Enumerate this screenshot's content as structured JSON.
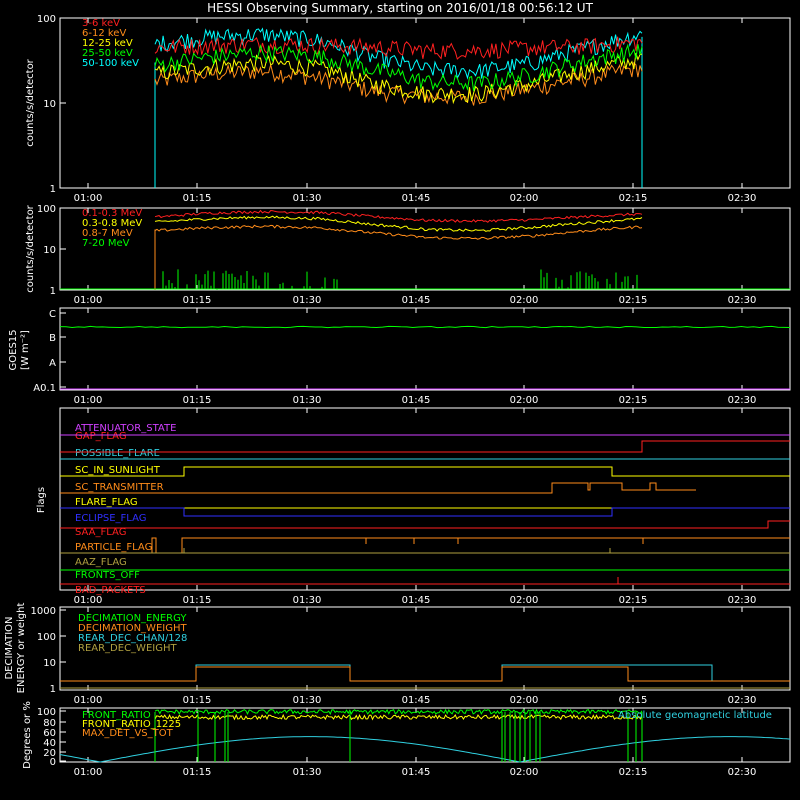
{
  "title": "HESSI Observing Summary, starting on 2016/01/18 00:56:12 UT",
  "x_ticks": [
    "01:00",
    "01:15",
    "01:30",
    "01:45",
    "02:00",
    "02:15",
    "02:30"
  ],
  "colors": {
    "red": "#ff2020",
    "orange": "#ff8c1a",
    "yellow": "#ffff00",
    "green": "#00ff00",
    "cyan": "#00ffff",
    "blue": "#3030ff",
    "magenta": "#d040ff",
    "olive": "#b0a040",
    "teal": "#30d0e0"
  },
  "chart_data": [
    {
      "type": "line",
      "ylabel": "counts/s/detector",
      "y_scale": "log",
      "ylim": [
        1,
        100
      ],
      "y_ticks": [
        "100",
        "10",
        "1"
      ],
      "x_range": [
        "00:56:12",
        "02:36:12"
      ],
      "data_span": [
        "01:09:30",
        "02:16:00"
      ],
      "series": [
        {
          "name": "3-6 keV",
          "color": "#ff2020",
          "values": [
            45,
            48,
            50,
            48,
            46,
            42,
            42,
            45,
            47,
            52
          ]
        },
        {
          "name": "6-12 keV",
          "color": "#ff8c1a",
          "values": [
            18,
            22,
            24,
            20,
            14,
            12,
            12,
            15,
            20,
            26
          ]
        },
        {
          "name": "12-25 keV",
          "color": "#ffff00",
          "values": [
            22,
            27,
            30,
            26,
            17,
            13,
            13,
            17,
            25,
            33
          ]
        },
        {
          "name": "25-50 keV",
          "color": "#00ff00",
          "values": [
            28,
            35,
            40,
            36,
            25,
            18,
            17,
            22,
            32,
            42
          ]
        },
        {
          "name": "50-100 keV",
          "color": "#00ffff",
          "values": [
            50,
            60,
            65,
            55,
            35,
            25,
            24,
            30,
            45,
            65
          ]
        }
      ]
    },
    {
      "type": "line",
      "ylabel": "counts/s/detector",
      "y_scale": "log",
      "ylim": [
        1,
        100
      ],
      "y_ticks": [
        "100",
        "10",
        "1"
      ],
      "series": [
        {
          "name": "0.1-0.3 MeV",
          "color": "#ff2020",
          "values": [
            60,
            75,
            82,
            78,
            62,
            50,
            48,
            52,
            62,
            72
          ]
        },
        {
          "name": "0.3-0.8 MeV",
          "color": "#ffff00",
          "values": [
            45,
            55,
            60,
            55,
            40,
            30,
            28,
            34,
            44,
            55
          ]
        },
        {
          "name": "0.8-7 MeV",
          "color": "#ff8c1a",
          "values": [
            28,
            33,
            36,
            33,
            25,
            19,
            18,
            21,
            28,
            35
          ]
        },
        {
          "name": "7-20 MeV",
          "color": "#00ff00",
          "values": [
            1.2,
            2,
            2,
            1.5,
            1,
            1,
            1,
            1.3,
            2,
            2
          ]
        }
      ]
    },
    {
      "type": "line",
      "ylabel": "GOES15 [W m-2]",
      "y_ticks": [
        "C",
        "B",
        "A",
        "A0.1"
      ],
      "series": [
        {
          "name": "GOES long",
          "color": "#00ff00",
          "values": [
            7.7,
            7.8,
            7.7,
            7.7,
            7.7,
            7.7,
            7.7,
            7.7,
            7.7,
            7.6
          ]
        },
        {
          "name": "GOES short",
          "color": "#d040ff",
          "values": [
            0,
            0,
            0,
            0,
            0,
            0,
            0,
            0,
            0,
            0
          ]
        }
      ]
    },
    {
      "type": "table",
      "ylabel": "Flags",
      "flags": [
        {
          "name": "ATTENUATOR_STATE",
          "color": "#d040ff"
        },
        {
          "name": "GAP_FLAG",
          "color": "#ff2020"
        },
        {
          "name": "POSSIBLE_FLARE",
          "color": "#30d0e0"
        },
        {
          "name": "SC_IN_SUNLIGHT",
          "color": "#ffff00"
        },
        {
          "name": "SC_TRANSMITTER",
          "color": "#ff8c1a"
        },
        {
          "name": "FLARE_FLAG",
          "color": "#ffff00"
        },
        {
          "name": "ECLIPSE_FLAG",
          "color": "#3030ff"
        },
        {
          "name": "SAA_FLAG",
          "color": "#ff2020"
        },
        {
          "name": "PARTICLE_FLAG",
          "color": "#ff8c1a"
        },
        {
          "name": "AAZ_FLAG",
          "color": "#b0a040"
        },
        {
          "name": "FRONTS_OFF",
          "color": "#00ff00"
        },
        {
          "name": "BAD_PACKETS",
          "color": "#ff2020"
        }
      ]
    },
    {
      "type": "line",
      "ylabel": "DECIMATION ENERGY or weight",
      "y_scale": "log",
      "y_ticks": [
        "1000",
        "100",
        "10",
        "1"
      ],
      "series": [
        {
          "name": "DECIMATION_ENERGY",
          "color": "#00ff00"
        },
        {
          "name": "DECIMATION_WEIGHT",
          "color": "#ff8c1a"
        },
        {
          "name": "REAR_DEC_CHAN/128",
          "color": "#30d0e0"
        },
        {
          "name": "REAR_DEC_WEIGHT",
          "color": "#b0a040"
        }
      ]
    },
    {
      "type": "line",
      "ylabel": "Degrees or %",
      "ylim": [
        0,
        100
      ],
      "y_ticks": [
        "100",
        "80",
        "60",
        "40",
        "20",
        "0"
      ],
      "series": [
        {
          "name": "FRONT_RATIO",
          "color": "#00ff00"
        },
        {
          "name": "FRONT_RATIO_1225",
          "color": "#ffff00"
        },
        {
          "name": "MAX_DET_VS_TOT",
          "color": "#ff8c1a"
        },
        {
          "name": "Absolute geomagnetic latitude",
          "color": "#30d0e0"
        }
      ]
    }
  ]
}
